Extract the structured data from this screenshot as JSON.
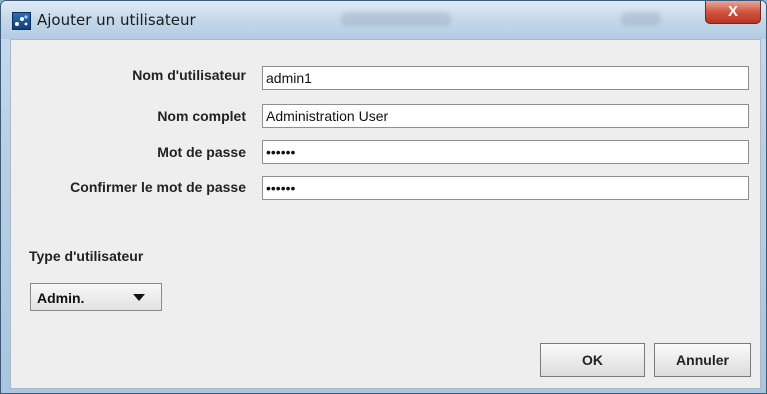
{
  "window": {
    "title": "Ajouter un utilisateur",
    "close_label": "X"
  },
  "form": {
    "username": {
      "label": "Nom d'utilisateur",
      "value": "admin1"
    },
    "fullname": {
      "label": "Nom complet",
      "value": "Administration User"
    },
    "password": {
      "label": "Mot de passe",
      "value": "••••••"
    },
    "confirm": {
      "label": "Confirmer le mot de passe",
      "value": "••••••"
    }
  },
  "user_type": {
    "label": "Type d'utilisateur",
    "selected": "Admin."
  },
  "buttons": {
    "ok": "OK",
    "cancel": "Annuler"
  }
}
